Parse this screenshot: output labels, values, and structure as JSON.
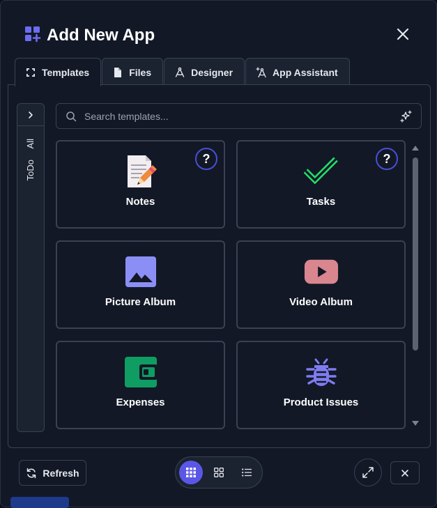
{
  "dialog": {
    "title": "Add New App",
    "logo_icon": "apps-add-icon",
    "close_icon": "close-icon"
  },
  "tabs": [
    {
      "label": "Templates",
      "icon": "grid-dots-icon",
      "active": true
    },
    {
      "label": "Files",
      "icon": "file-icon",
      "active": false
    },
    {
      "label": "Designer",
      "icon": "compass-drafting-icon",
      "active": false
    },
    {
      "label": "App Assistant",
      "icon": "sparkle-compass-icon",
      "active": false
    }
  ],
  "sidebar": {
    "toggle_icon": "chevron-right-icon",
    "items": [
      {
        "label": "All"
      },
      {
        "label": "ToDo"
      }
    ]
  },
  "search": {
    "placeholder": "Search templates...",
    "value": "",
    "icon": "search-icon",
    "ai_icon": "sparkle-icon"
  },
  "templates": [
    {
      "label": "Notes",
      "icon": "memo-pencil-icon",
      "help": "?"
    },
    {
      "label": "Tasks",
      "icon": "checkmark-icon",
      "help": "?"
    },
    {
      "label": "Picture Album",
      "icon": "image-icon"
    },
    {
      "label": "Video Album",
      "icon": "youtube-play-icon"
    },
    {
      "label": "Expenses",
      "icon": "wallet-icon"
    },
    {
      "label": "Product Issues",
      "icon": "bug-icon"
    }
  ],
  "footer": {
    "refresh_label": "Refresh",
    "views": [
      {
        "name": "large-grid-view",
        "active": true
      },
      {
        "name": "grid-view",
        "active": false
      },
      {
        "name": "list-view",
        "active": false
      }
    ]
  },
  "colors": {
    "accent": "#5b57e6",
    "tasks_green": "#22e06b",
    "picture_purple": "#8b8ff5",
    "video_pink": "#d9868f",
    "expenses_green": "#0f9d63",
    "bug_purple": "#7f7cf0"
  }
}
